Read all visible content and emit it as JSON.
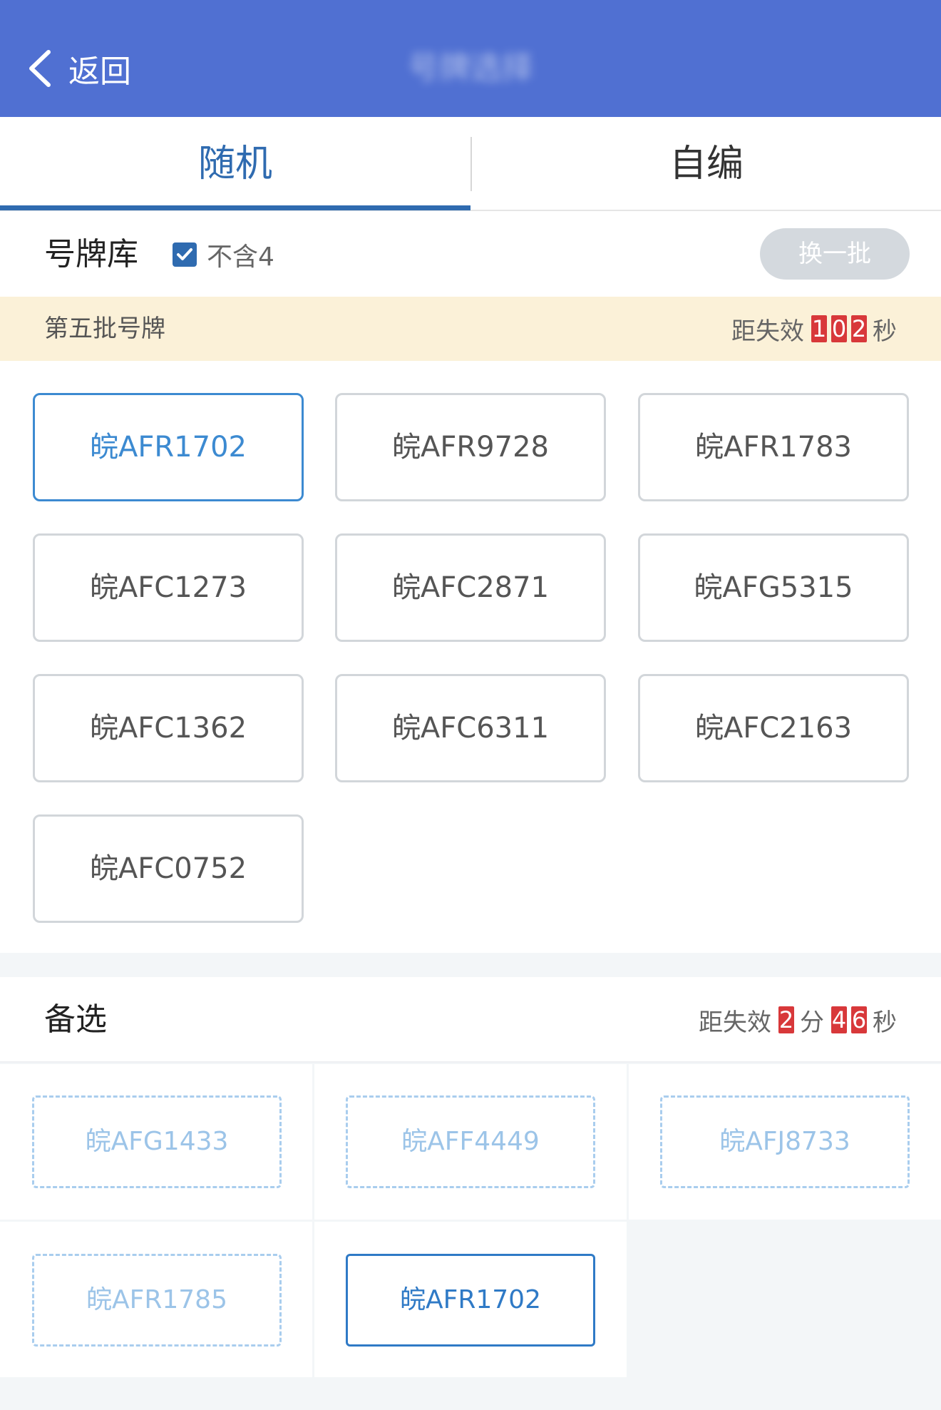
{
  "header": {
    "back_label": "返回",
    "title": "号牌选择"
  },
  "tabs": [
    {
      "label": "随机",
      "active": true
    },
    {
      "label": "自编",
      "active": false
    }
  ],
  "library": {
    "title": "号牌库",
    "exclude_label": "不含4",
    "exclude_checked": true,
    "refresh_label": "换一批"
  },
  "notice": {
    "batch_label": "第五批号牌",
    "expire_prefix": "距失效",
    "seconds_digits": [
      "1",
      "0",
      "2"
    ],
    "seconds_unit": "秒"
  },
  "plates": [
    {
      "text": "皖AFR1702",
      "selected": true
    },
    {
      "text": "皖AFR9728",
      "selected": false
    },
    {
      "text": "皖AFR1783",
      "selected": false
    },
    {
      "text": "皖AFC1273",
      "selected": false
    },
    {
      "text": "皖AFC2871",
      "selected": false
    },
    {
      "text": "皖AFG5315",
      "selected": false
    },
    {
      "text": "皖AFC1362",
      "selected": false
    },
    {
      "text": "皖AFC6311",
      "selected": false
    },
    {
      "text": "皖AFC2163",
      "selected": false
    },
    {
      "text": "皖AFC0752",
      "selected": false
    }
  ],
  "alternates": {
    "title": "备选",
    "expire_prefix": "距失效",
    "minutes_digits": [
      "2"
    ],
    "minutes_unit": "分",
    "seconds_digits": [
      "4",
      "6"
    ],
    "seconds_unit": "秒",
    "items": [
      {
        "text": "皖AFG1433",
        "chosen": false
      },
      {
        "text": "皖AFF4449",
        "chosen": false
      },
      {
        "text": "皖AFJ8733",
        "chosen": false
      },
      {
        "text": "皖AFR1785",
        "chosen": false
      },
      {
        "text": "皖AFR1702",
        "chosen": true
      }
    ]
  },
  "colors": {
    "header_bg": "#5070d2",
    "accent": "#2f6bb0",
    "countdown_red": "#d8383a",
    "notice_bg": "#fbf1d8"
  }
}
